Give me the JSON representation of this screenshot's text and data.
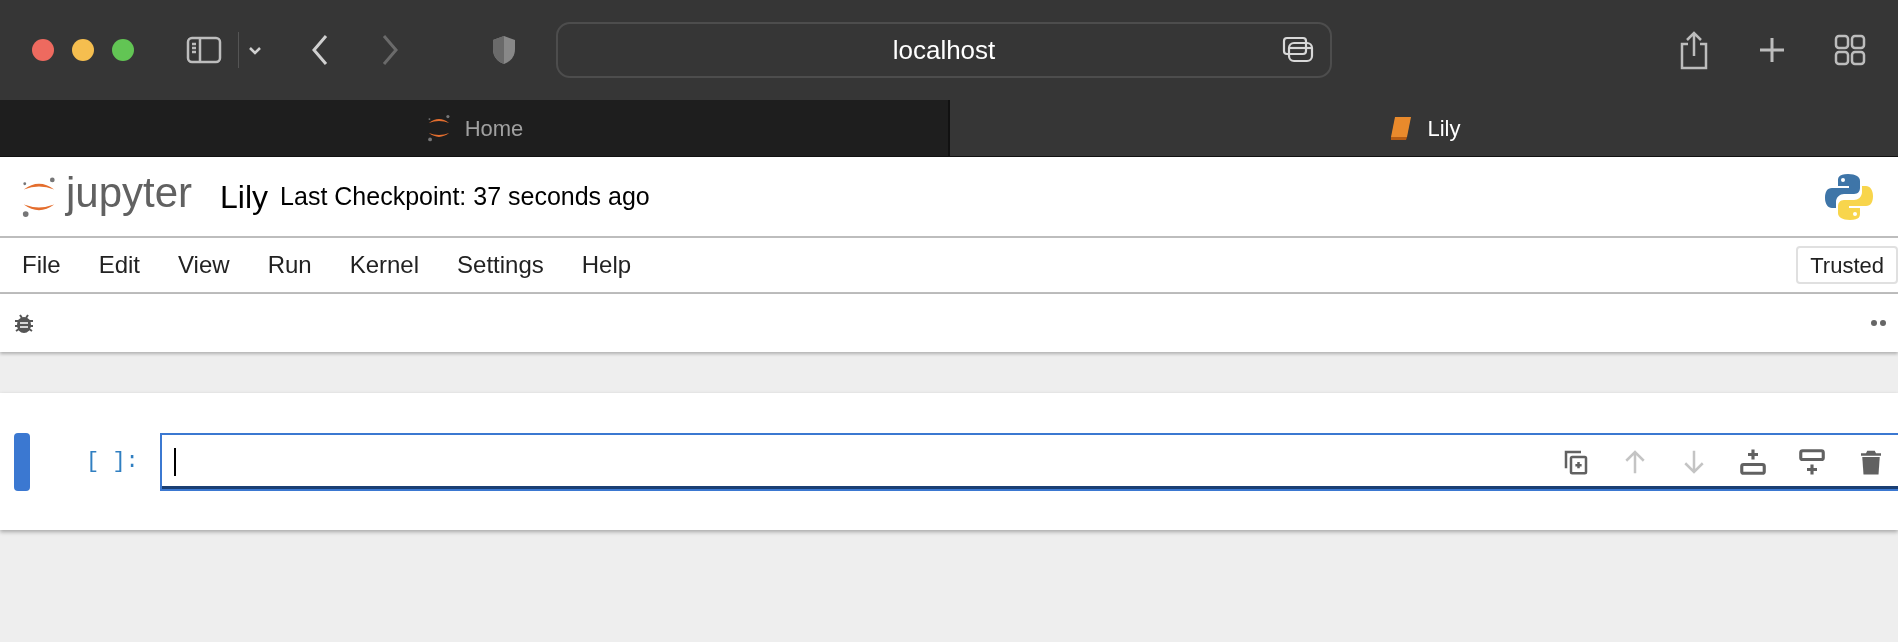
{
  "browser": {
    "address": "localhost",
    "back_disabled": false,
    "forward_disabled": true
  },
  "tabs": [
    {
      "label": "Home",
      "selected": false,
      "kind": "jupyter"
    },
    {
      "label": "Lily",
      "selected": true,
      "kind": "notebook"
    }
  ],
  "header": {
    "logo_text": "jupyter",
    "notebook_name": "Lily",
    "checkpoint": "Last Checkpoint: 37 seconds ago"
  },
  "menu": [
    "File",
    "Edit",
    "View",
    "Run",
    "Kernel",
    "Settings",
    "Help"
  ],
  "trusted_button": "Trusted",
  "cell": {
    "prompt": "[ ]:",
    "selected": true,
    "actions": [
      {
        "kind": "duplicate",
        "disabled": false
      },
      {
        "kind": "up",
        "disabled": true
      },
      {
        "kind": "down",
        "disabled": true
      },
      {
        "kind": "insert-above",
        "disabled": false
      },
      {
        "kind": "insert-below",
        "disabled": false
      },
      {
        "kind": "delete",
        "disabled": false
      }
    ]
  }
}
